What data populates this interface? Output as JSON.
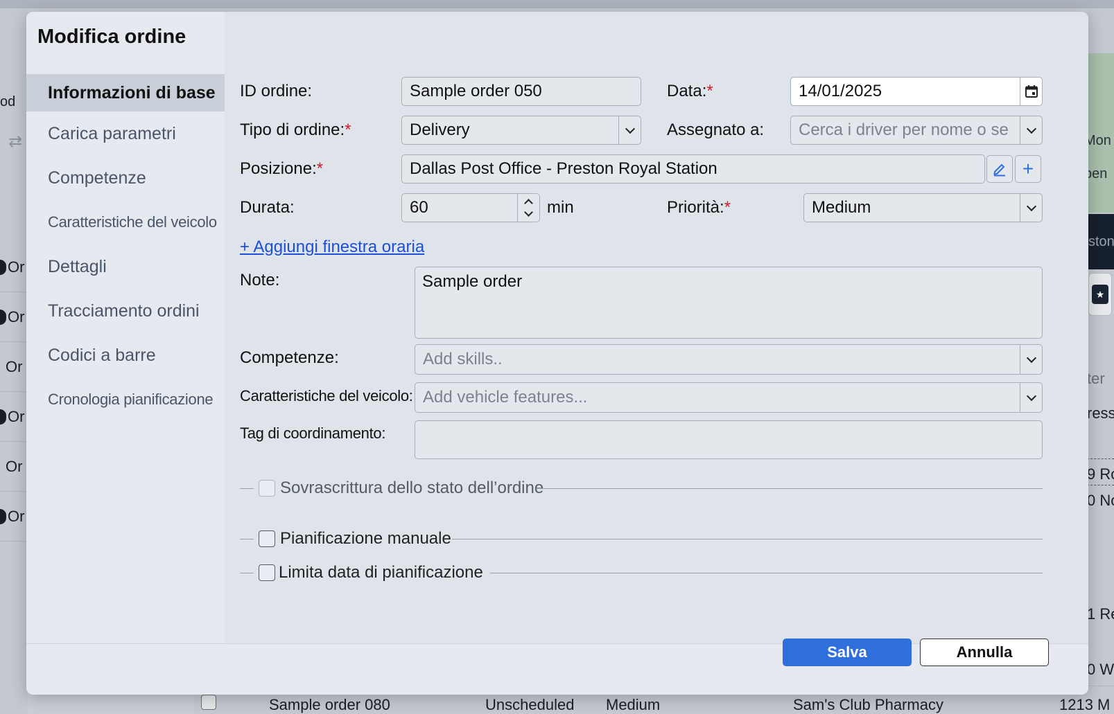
{
  "background": {
    "left_partial": "od",
    "left_rows": [
      "Or",
      "Or",
      "Or",
      "Or",
      "Or",
      "Or"
    ],
    "right_partial": [
      "Mon",
      "pen",
      "ston",
      "ter",
      "ress",
      "9 Ro",
      "0 No",
      "1 Re",
      "0 W"
    ],
    "bottom_row": {
      "name": "Sample order 080",
      "status": "Unscheduled",
      "priority": "Medium",
      "location": "Sam's Club Pharmacy",
      "address": "1213 M"
    }
  },
  "modal": {
    "title": "Modifica ordine",
    "nav": [
      {
        "label": "Informazioni di base",
        "active": true
      },
      {
        "label": "Carica parametri"
      },
      {
        "label": "Competenze"
      },
      {
        "label": "Caratteristiche del veicolo"
      },
      {
        "label": "Dettagli"
      },
      {
        "label": "Tracciamento ordini"
      },
      {
        "label": "Codici a barre"
      },
      {
        "label": "Cronologia pianificazione"
      }
    ],
    "form": {
      "order_id_label": "ID ordine:",
      "order_id_value": "Sample order 050",
      "date_label": "Data:",
      "date_value": "14/01/2025",
      "order_type_label": "Tipo di ordine:",
      "order_type_value": "Delivery",
      "assigned_label": "Assegnato a:",
      "assigned_placeholder": "Cerca i driver per nome o se",
      "position_label": "Posizione:",
      "position_value": "Dallas Post Office - Preston Royal Station",
      "duration_label": "Durata:",
      "duration_value": "60",
      "duration_unit": "min",
      "priority_label": "Priorità:",
      "priority_value": "Medium",
      "add_window_link": "+ Aggiungi finestra oraria",
      "notes_label": "Note:",
      "notes_value": "Sample order",
      "skills_label": "Competenze:",
      "skills_placeholder": "Add skills..",
      "vehicle_label": "Caratteristiche del veicolo:",
      "vehicle_placeholder": "Add vehicle features...",
      "coord_tag_label": "Tag di coordinamento:",
      "coord_tag_value": "",
      "required_mark": "*",
      "override_label": "Sovrascrittura dello stato dell’ordine",
      "manual_label": "Pianificazione manuale",
      "limit_label": "Limita data di pianificazione"
    },
    "buttons": {
      "save": "Salva",
      "cancel": "Annulla"
    }
  },
  "colors": {
    "primary": "#2f6fdc",
    "required": "#d0192a",
    "link": "#1d4fd8"
  }
}
